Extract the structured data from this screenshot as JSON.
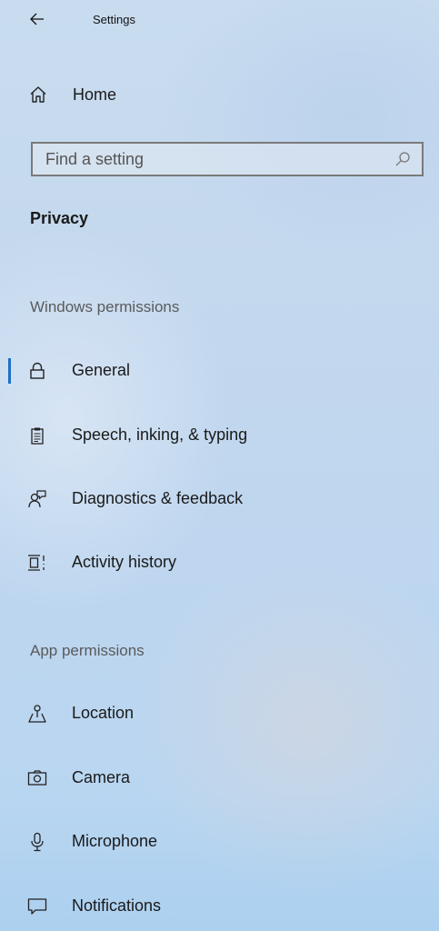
{
  "window": {
    "title": "Settings",
    "back_icon": "back-arrow-icon"
  },
  "home": {
    "label": "Home",
    "icon": "home-icon"
  },
  "search": {
    "placeholder": "Find a setting",
    "value": "",
    "icon": "search-icon"
  },
  "section": {
    "title": "Privacy"
  },
  "groups": [
    {
      "label": "Windows permissions",
      "items": [
        {
          "label": "General",
          "icon": "lock-icon",
          "selected": true
        },
        {
          "label": "Speech, inking, & typing",
          "icon": "clipboard-icon",
          "selected": false
        },
        {
          "label": "Diagnostics & feedback",
          "icon": "feedback-person-icon",
          "selected": false
        },
        {
          "label": "Activity history",
          "icon": "activity-history-icon",
          "selected": false
        }
      ]
    },
    {
      "label": "App permissions",
      "items": [
        {
          "label": "Location",
          "icon": "location-icon",
          "selected": false
        },
        {
          "label": "Camera",
          "icon": "camera-icon",
          "selected": false
        },
        {
          "label": "Microphone",
          "icon": "microphone-icon",
          "selected": false
        },
        {
          "label": "Notifications",
          "icon": "notifications-icon",
          "selected": false
        }
      ]
    }
  ],
  "colors": {
    "accent": "#1f6fc4",
    "text": "#1a1a1a",
    "group_label": "#5a5a5a"
  }
}
